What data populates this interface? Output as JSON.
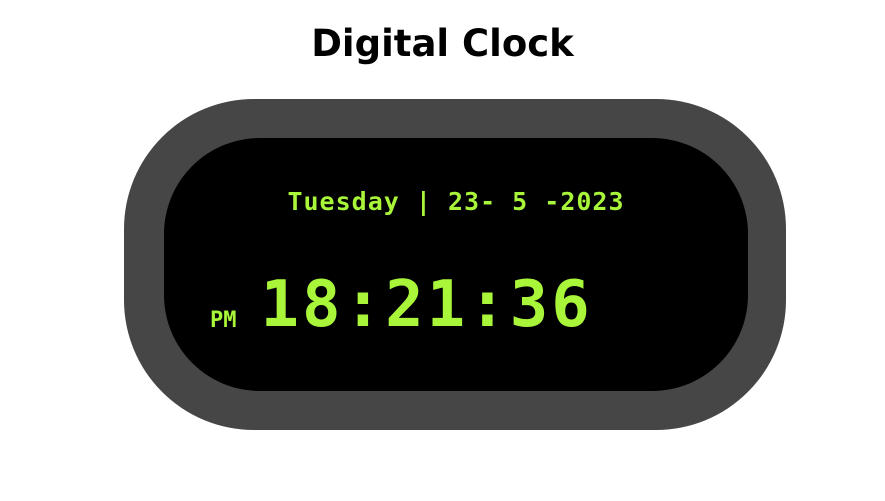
{
  "page": {
    "title": "Digital Clock"
  },
  "clock": {
    "date_display": "Tuesday | 23- 5 -2023",
    "period": "PM",
    "time": "18:21:36"
  },
  "colors": {
    "display_text": "#a8f53a",
    "bezel": "#464646",
    "screen": "#000000",
    "background": "#ffffff"
  }
}
